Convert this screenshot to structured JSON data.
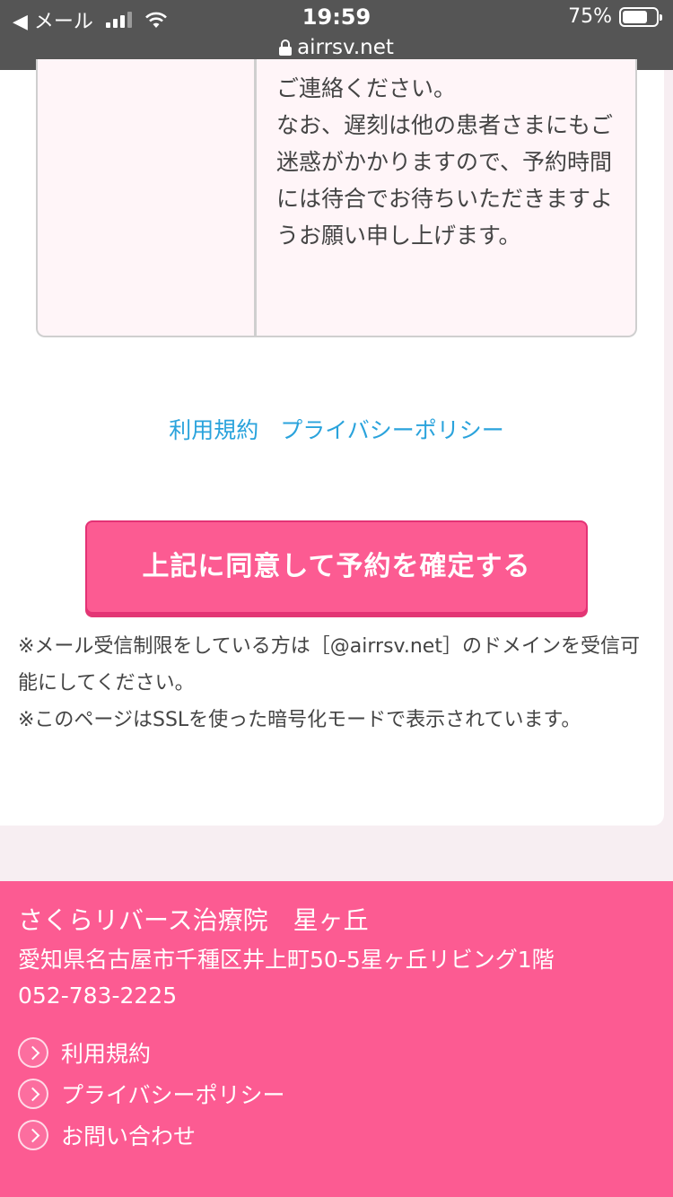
{
  "status_bar": {
    "back_label": "◀ メール",
    "time": "19:59",
    "battery": "75%",
    "url": "airrsv.net"
  },
  "notes": {
    "text": "ご連絡ください。\nなお、遅刻は他の患者さまにもご迷惑がかかりますので、予約時間には待合でお待ちいただきますようお願い申し上げます。"
  },
  "links": {
    "terms": "利用規約",
    "privacy": "プライバシーポリシー"
  },
  "confirm_button": "上記に同意して予約を確定する",
  "notices": {
    "line1": "※メール受信制限をしている方は［@airrsv.net］のドメインを受信可能にしてください。",
    "line2": "※このページはSSLを使った暗号化モードで表示されています。"
  },
  "footer": {
    "clinic_name": "さくらリバース治療院　星ヶ丘",
    "address": "愛知県名古屋市千種区井上町50-5星ヶ丘リビング1階",
    "phone": "052-783-2225",
    "links": [
      "利用規約",
      "プライバシーポリシー",
      "お問い合わせ"
    ]
  },
  "colors": {
    "accent": "#fc5b92",
    "link": "#2aa3dc",
    "status_bar": "#555555"
  },
  "battery_level": 0.75
}
